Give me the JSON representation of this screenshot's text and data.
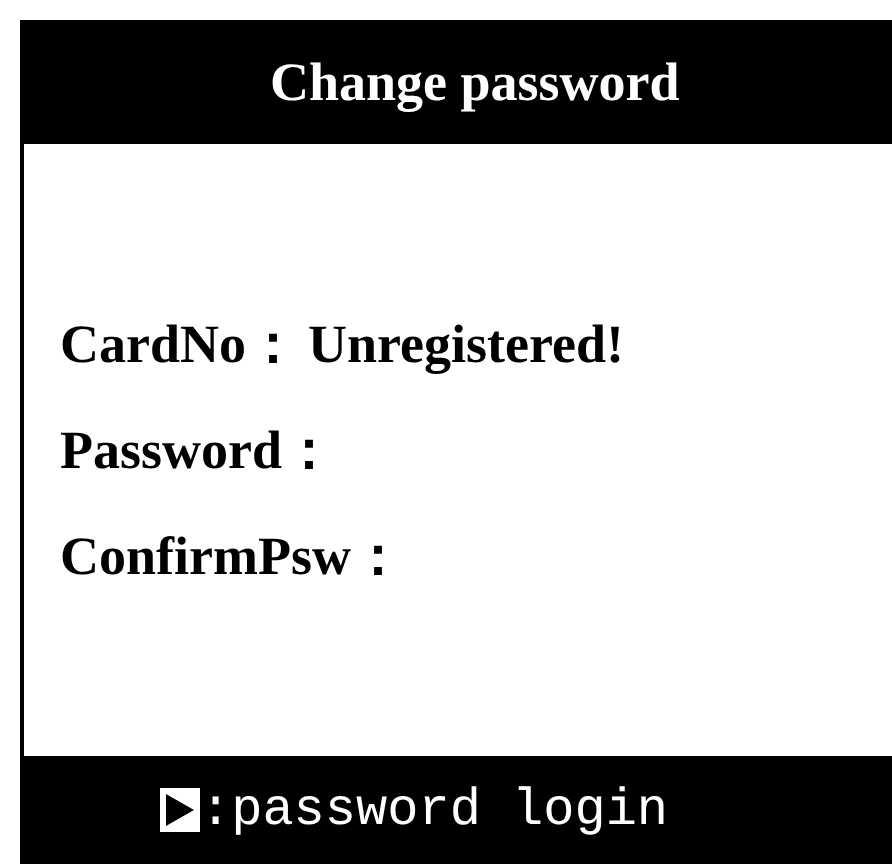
{
  "title": "Change password",
  "fields": [
    {
      "label": "CardNo：",
      "value": "Unregistered!"
    },
    {
      "label": "Password："
    },
    {
      "label": "ConfirmPsw："
    }
  ],
  "footer": {
    "hint": ":password login"
  }
}
